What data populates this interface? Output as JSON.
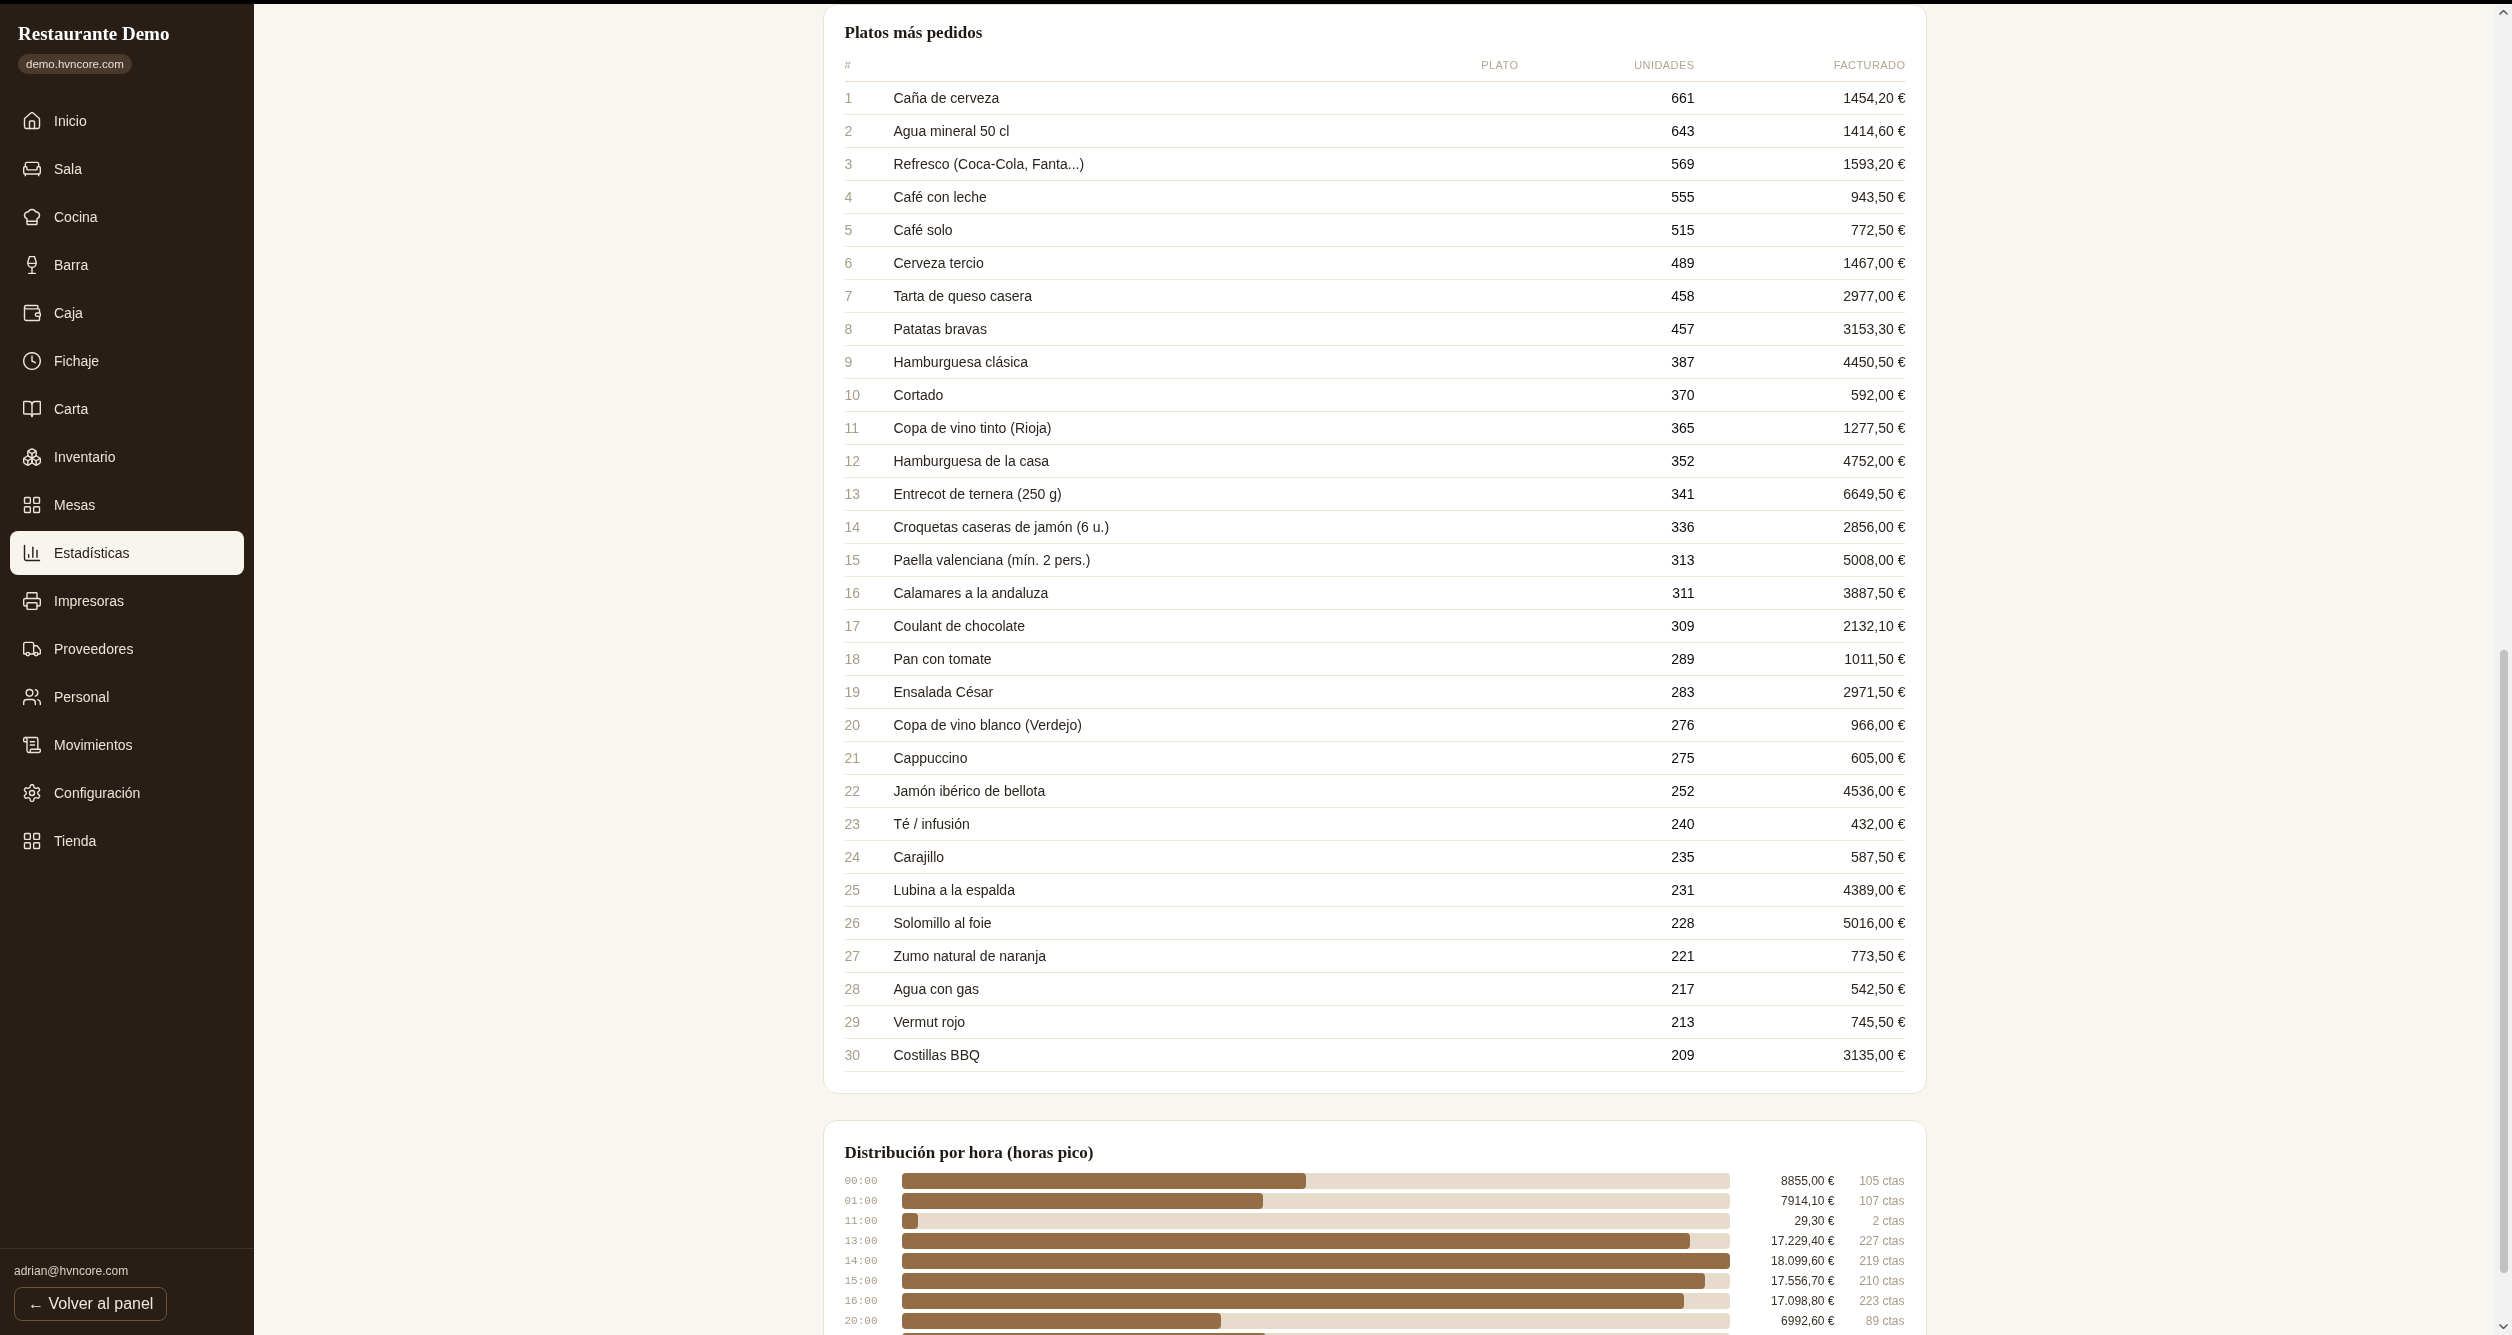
{
  "sidebar": {
    "title": "Restaurante Demo",
    "domain": "demo.hvncore.com",
    "items": [
      {
        "label": "Inicio",
        "selected": false
      },
      {
        "label": "Sala",
        "selected": false
      },
      {
        "label": "Cocina",
        "selected": false
      },
      {
        "label": "Barra",
        "selected": false
      },
      {
        "label": "Caja",
        "selected": false
      },
      {
        "label": "Fichaje",
        "selected": false
      },
      {
        "label": "Carta",
        "selected": false
      },
      {
        "label": "Inventario",
        "selected": false
      },
      {
        "label": "Mesas",
        "selected": false
      },
      {
        "label": "Estadísticas",
        "selected": true
      },
      {
        "label": "Impresoras",
        "selected": false
      },
      {
        "label": "Proveedores",
        "selected": false
      },
      {
        "label": "Personal",
        "selected": false
      },
      {
        "label": "Movimientos",
        "selected": false
      },
      {
        "label": "Configuración",
        "selected": false
      },
      {
        "label": "Tienda",
        "selected": false
      }
    ],
    "user_email": "adrian@hvncore.com",
    "back_button": "← Volver al panel"
  },
  "top_dishes": {
    "title": "Platos más pedidos",
    "columns": [
      "#",
      "PLATO",
      "UNIDADES",
      "FACTURADO"
    ],
    "rows": [
      {
        "rank": "1",
        "dish": "Caña de cerveza",
        "units": "661",
        "revenue": "1454,20 €"
      },
      {
        "rank": "2",
        "dish": "Agua mineral 50 cl",
        "units": "643",
        "revenue": "1414,60 €"
      },
      {
        "rank": "3",
        "dish": "Refresco (Coca-Cola, Fanta...)",
        "units": "569",
        "revenue": "1593,20 €"
      },
      {
        "rank": "4",
        "dish": "Café con leche",
        "units": "555",
        "revenue": "943,50 €"
      },
      {
        "rank": "5",
        "dish": "Café solo",
        "units": "515",
        "revenue": "772,50 €"
      },
      {
        "rank": "6",
        "dish": "Cerveza tercio",
        "units": "489",
        "revenue": "1467,00 €"
      },
      {
        "rank": "7",
        "dish": "Tarta de queso casera",
        "units": "458",
        "revenue": "2977,00 €"
      },
      {
        "rank": "8",
        "dish": "Patatas bravas",
        "units": "457",
        "revenue": "3153,30 €"
      },
      {
        "rank": "9",
        "dish": "Hamburguesa clásica",
        "units": "387",
        "revenue": "4450,50 €"
      },
      {
        "rank": "10",
        "dish": "Cortado",
        "units": "370",
        "revenue": "592,00 €"
      },
      {
        "rank": "11",
        "dish": "Copa de vino tinto (Rioja)",
        "units": "365",
        "revenue": "1277,50 €"
      },
      {
        "rank": "12",
        "dish": "Hamburguesa de la casa",
        "units": "352",
        "revenue": "4752,00 €"
      },
      {
        "rank": "13",
        "dish": "Entrecot de ternera (250 g)",
        "units": "341",
        "revenue": "6649,50 €"
      },
      {
        "rank": "14",
        "dish": "Croquetas caseras de jamón (6 u.)",
        "units": "336",
        "revenue": "2856,00 €"
      },
      {
        "rank": "15",
        "dish": "Paella valenciana (mín. 2 pers.)",
        "units": "313",
        "revenue": "5008,00 €"
      },
      {
        "rank": "16",
        "dish": "Calamares a la andaluza",
        "units": "311",
        "revenue": "3887,50 €"
      },
      {
        "rank": "17",
        "dish": "Coulant de chocolate",
        "units": "309",
        "revenue": "2132,10 €"
      },
      {
        "rank": "18",
        "dish": "Pan con tomate",
        "units": "289",
        "revenue": "1011,50 €"
      },
      {
        "rank": "19",
        "dish": "Ensalada César",
        "units": "283",
        "revenue": "2971,50 €"
      },
      {
        "rank": "20",
        "dish": "Copa de vino blanco (Verdejo)",
        "units": "276",
        "revenue": "966,00 €"
      },
      {
        "rank": "21",
        "dish": "Cappuccino",
        "units": "275",
        "revenue": "605,00 €"
      },
      {
        "rank": "22",
        "dish": "Jamón ibérico de bellota",
        "units": "252",
        "revenue": "4536,00 €"
      },
      {
        "rank": "23",
        "dish": "Té / infusión",
        "units": "240",
        "revenue": "432,00 €"
      },
      {
        "rank": "24",
        "dish": "Carajillo",
        "units": "235",
        "revenue": "587,50 €"
      },
      {
        "rank": "25",
        "dish": "Lubina a la espalda",
        "units": "231",
        "revenue": "4389,00 €"
      },
      {
        "rank": "26",
        "dish": "Solomillo al foie",
        "units": "228",
        "revenue": "5016,00 €"
      },
      {
        "rank": "27",
        "dish": "Zumo natural de naranja",
        "units": "221",
        "revenue": "773,50 €"
      },
      {
        "rank": "28",
        "dish": "Agua con gas",
        "units": "217",
        "revenue": "542,50 €"
      },
      {
        "rank": "29",
        "dish": "Vermut rojo",
        "units": "213",
        "revenue": "745,50 €"
      },
      {
        "rank": "30",
        "dish": "Costillas BBQ",
        "units": "209",
        "revenue": "3135,00 €"
      }
    ]
  },
  "hourly": {
    "title": "Distribución por hora (horas pico)",
    "rows": [
      {
        "hour": "00:00",
        "level": 0.489,
        "amount": "8855,00 €",
        "tickets": "105 ctas"
      },
      {
        "hour": "01:00",
        "level": 0.437,
        "amount": "7914,10 €",
        "tickets": "107 ctas"
      },
      {
        "hour": "11:00",
        "level": 0.02,
        "amount": "29,30 €",
        "tickets": "2 ctas"
      },
      {
        "hour": "13:00",
        "level": 0.952,
        "amount": "17.229,40 €",
        "tickets": "227 ctas"
      },
      {
        "hour": "14:00",
        "level": 1,
        "amount": "18.099,60 €",
        "tickets": "219 ctas"
      },
      {
        "hour": "15:00",
        "level": 0.97,
        "amount": "17.556,70 €",
        "tickets": "210 ctas"
      },
      {
        "hour": "16:00",
        "level": 0.945,
        "amount": "17.098,80 €",
        "tickets": "223 ctas"
      },
      {
        "hour": "20:00",
        "level": 0.386,
        "amount": "6992,60 €",
        "tickets": "89 ctas"
      },
      {
        "level": 0.44
      }
    ]
  }
}
